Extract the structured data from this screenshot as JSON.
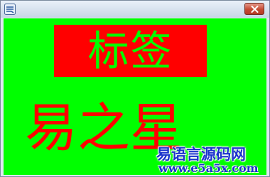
{
  "window": {
    "icon": "app-icon",
    "close_icon": "close-icon"
  },
  "content": {
    "label_text": "标签",
    "big_text": "易之星"
  },
  "watermark": {
    "title": "易语言源码网",
    "url": "www.e5a5x.com"
  },
  "colors": {
    "background": "#00ff00",
    "label_background": "#ff0000",
    "label_text": "#00ff00",
    "big_text": "#ff0000",
    "watermark": "#1a33cc"
  }
}
